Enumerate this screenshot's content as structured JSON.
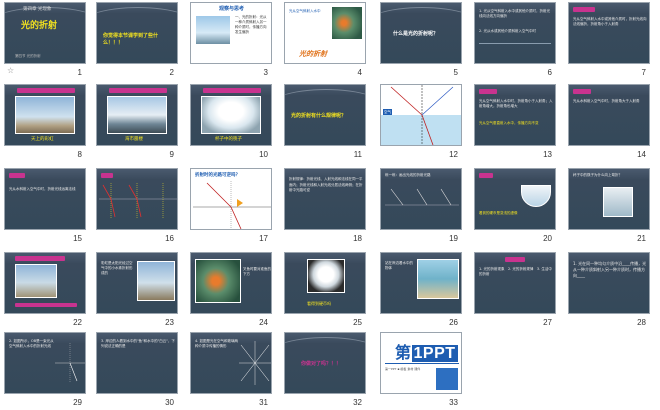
{
  "slides": [
    {
      "num": "1",
      "title": "光的折射"
    },
    {
      "num": "2",
      "title": "你觉得本节课学到了些什么！！！"
    },
    {
      "num": "3",
      "title": "观察与思考"
    },
    {
      "num": "4",
      "title": "光的折射"
    },
    {
      "num": "5",
      "title": "什么是光的折射呢？"
    },
    {
      "num": "6",
      "title": ""
    },
    {
      "num": "7",
      "title": ""
    },
    {
      "num": "8",
      "caption": "天上的彩虹"
    },
    {
      "num": "9",
      "caption": "海市蜃楼"
    },
    {
      "num": "10",
      "caption": "杯子中的筷子"
    },
    {
      "num": "11",
      "title": "光的折射有什么规律呢？"
    },
    {
      "num": "12",
      "title": ""
    },
    {
      "num": "13",
      "title": ""
    },
    {
      "num": "14",
      "title": ""
    },
    {
      "num": "15",
      "title": ""
    },
    {
      "num": "16",
      "title": ""
    },
    {
      "num": "17",
      "title": "折射时的光路可逆吗？"
    },
    {
      "num": "18",
      "title": ""
    },
    {
      "num": "19",
      "title": ""
    },
    {
      "num": "20",
      "title": ""
    },
    {
      "num": "21",
      "title": ""
    },
    {
      "num": "22",
      "title": ""
    },
    {
      "num": "23",
      "title": ""
    },
    {
      "num": "24",
      "title": ""
    },
    {
      "num": "25",
      "caption": "看得到硬币吗"
    },
    {
      "num": "26",
      "title": ""
    },
    {
      "num": "27",
      "title": ""
    },
    {
      "num": "28",
      "title": ""
    },
    {
      "num": "29",
      "title": ""
    },
    {
      "num": "30",
      "title": ""
    },
    {
      "num": "31",
      "title": ""
    },
    {
      "num": "32",
      "title": "你做对了吗？！！"
    },
    {
      "num": "33",
      "brand": "1PPT",
      "brand_prefix": "第"
    }
  ],
  "colors": {
    "slide_bg": "#3a4a5c",
    "magenta": "#c8338f",
    "yellow": "#f0e020",
    "blue_brand": "#1e5db1"
  }
}
